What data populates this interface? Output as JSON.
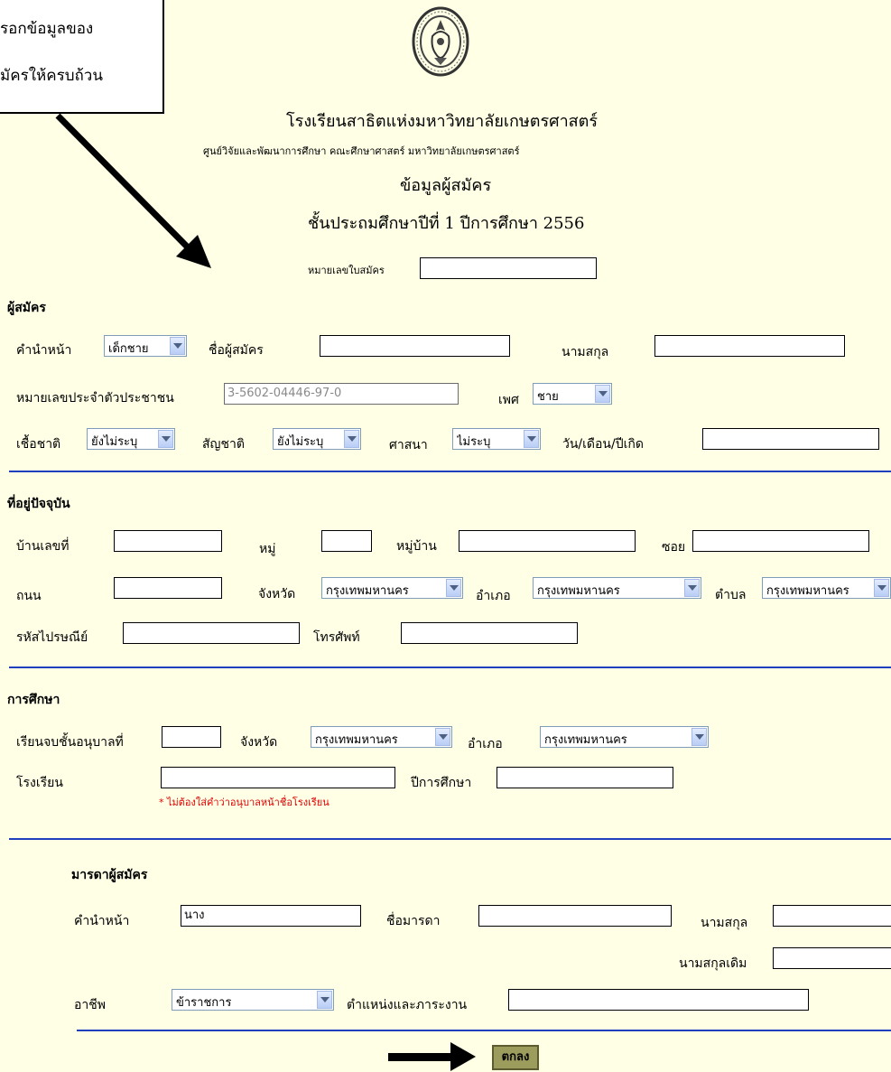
{
  "note": {
    "line1": "รอกข้อมูลของ",
    "line2": "มัครให้ครบถ้วน"
  },
  "header": {
    "school_name": "โรงเรียนสาธิตแห่งมหาวิทยาลัยเกษตรศาสตร์",
    "center_name": "ศูนย์วิจัยและพัฒนาการศึกษา คณะศึกษาศาสตร์ มหาวิทยาลัยเกษตรศาสตร์",
    "form_title": "ข้อมูลผู้สมัคร",
    "grade_year": "ชั้นประถมศึกษาปีที่ 1 ปีการศึกษา 2556",
    "application_no_label": "หมายเลขใบสมัคร",
    "application_no_value": ""
  },
  "applicant": {
    "section_title": "ผู้สมัคร",
    "prefix_label": "คำนำหน้า",
    "prefix_value": "เด็กชาย",
    "name_label": "ชื่อผู้สมัคร",
    "name_value": "",
    "surname_label": "นามสกุล",
    "surname_value": "",
    "id_label": "หมายเลขประจำตัวประชาชน",
    "id_value": "3-5602-04446-97-0",
    "sex_label": "เพศ",
    "sex_value": "ชาย",
    "ethnicity_label": "เชื้อชาติ",
    "ethnicity_value": "ยังไม่ระบุ",
    "nationality_label": "สัญชาติ",
    "nationality_value": "ยังไม่ระบุ",
    "religion_label": "ศาสนา",
    "religion_value": "ไม่ระบุ",
    "birthdate_label": "วัน/เดือน/ปีเกิด",
    "birthdate_value": ""
  },
  "address": {
    "section_title": "ที่อยู่ปัจจุบัน",
    "house_no_label": "บ้านเลขที่",
    "moo_label": "หมู่",
    "village_label": "หมู่บ้าน",
    "soi_label": "ซอย",
    "road_label": "ถนน",
    "province_label": "จังหวัด",
    "province_value": "กรุงเทพมหานคร",
    "district_label": "อำเภอ",
    "district_value": "กรุงเทพมหานคร",
    "subdistrict_label": "ตำบล",
    "subdistrict_value": "กรุงเทพมหานคร",
    "postal_label": "รหัสไปรษณีย์",
    "phone_label": "โทรศัพท์"
  },
  "education": {
    "section_title": "การศึกษา",
    "kindergarten_label": "เรียนจบชั้นอนุบาลที่",
    "province_label": "จังหวัด",
    "province_value": "กรุงเทพมหานคร",
    "district_label": "อำเภอ",
    "district_value": "กรุงเทพมหานคร",
    "school_label": "โรงเรียน",
    "school_year_label": "ปีการศึกษา",
    "school_note": "* ไม่ต้องใส่คำว่าอนุบาลหน้าชื่อโรงเรียน"
  },
  "mother": {
    "section_title": "มารดาผู้สมัคร",
    "prefix_label": "คำนำหน้า",
    "prefix_value": "นาง",
    "name_label": "ชื่อมารดา",
    "surname_label": "นามสกุล",
    "maiden_label": "นามสกุลเดิม",
    "occupation_label": "อาชีพ",
    "occupation_value": "ข้าราชการ",
    "position_label": "ตำแหน่งและภาระงาน"
  },
  "submit": {
    "label": "ตกลง"
  },
  "colors": {
    "background": "#ffffe6",
    "divider": "#1f3fbf",
    "note_red": "#e00000",
    "button": "#9c9c5c"
  }
}
